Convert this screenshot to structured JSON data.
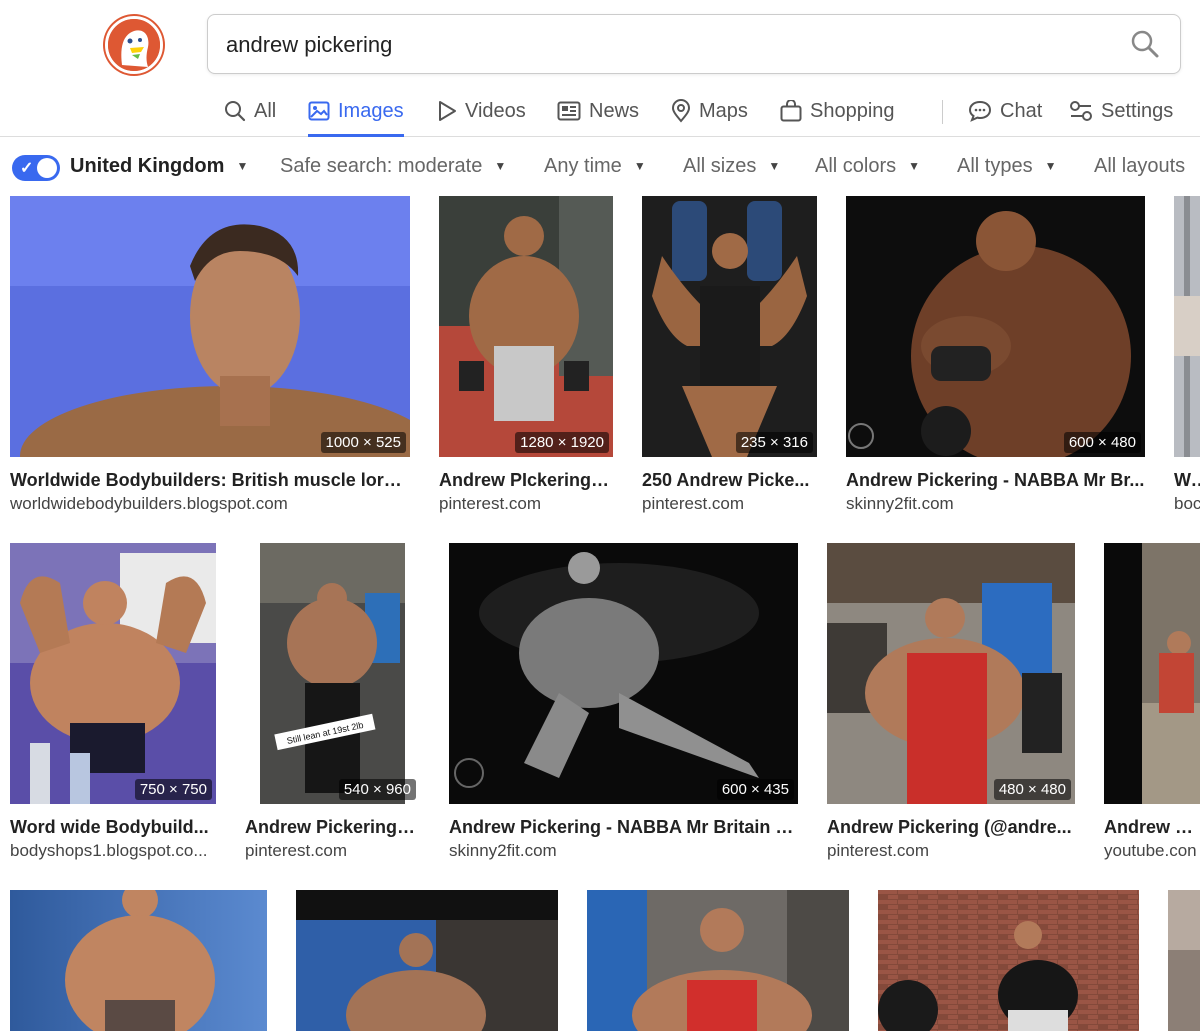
{
  "search": {
    "query": "andrew pickering"
  },
  "tabs": [
    {
      "label": "All"
    },
    {
      "label": "Images"
    },
    {
      "label": "Videos"
    },
    {
      "label": "News"
    },
    {
      "label": "Maps"
    },
    {
      "label": "Shopping"
    },
    {
      "label": "Chat"
    },
    {
      "label": "Settings"
    }
  ],
  "active_tab": "Images",
  "filters": {
    "region": "United Kingdom",
    "safe_search": "Safe search: moderate",
    "time": "Any time",
    "size": "All sizes",
    "color": "All colors",
    "type": "All types",
    "layout": "All layouts"
  },
  "colors": {
    "accent": "#3969ef",
    "logo": "#de5833"
  },
  "results": [
    {
      "dims": "1000 × 525",
      "title": "Worldwide Bodybuilders: British muscle lord ...",
      "source": "worldwidebodybuilders.blogspot.com"
    },
    {
      "dims": "1280 × 1920",
      "title": "Andrew PIckering |...",
      "source": "pinterest.com"
    },
    {
      "dims": "235 × 316",
      "title": "250 Andrew Picke...",
      "source": "pinterest.com"
    },
    {
      "dims": "600 × 480",
      "title": "Andrew Pickering - NABBA Mr Br...",
      "source": "skinny2fit.com"
    },
    {
      "dims": "",
      "title": "Wo",
      "source": "boc"
    },
    {
      "dims": "750 × 750",
      "title": "Word wide Bodybuild...",
      "source": "bodyshops1.blogspot.co..."
    },
    {
      "dims": "540 × 960",
      "title": "Andrew Pickering |...",
      "source": "pinterest.com"
    },
    {
      "dims": "600 × 435",
      "title": "Andrew Pickering - NABBA Mr Britain - ...",
      "source": "skinny2fit.com"
    },
    {
      "dims": "480 × 480",
      "title": "Andrew Pickering (@andre...",
      "source": "pinterest.com"
    },
    {
      "dims": "",
      "title": "Andrew Pic",
      "source": "youtube.con"
    },
    {
      "dims": "",
      "title": "",
      "source": ""
    },
    {
      "dims": "",
      "title": "",
      "source": ""
    },
    {
      "dims": "",
      "title": "",
      "source": ""
    },
    {
      "dims": "",
      "title": "",
      "source": ""
    },
    {
      "dims": "",
      "title": "",
      "source": ""
    }
  ],
  "image_captions": {
    "r2_tile2_overlay": "Still lean at 19st 2lb"
  }
}
